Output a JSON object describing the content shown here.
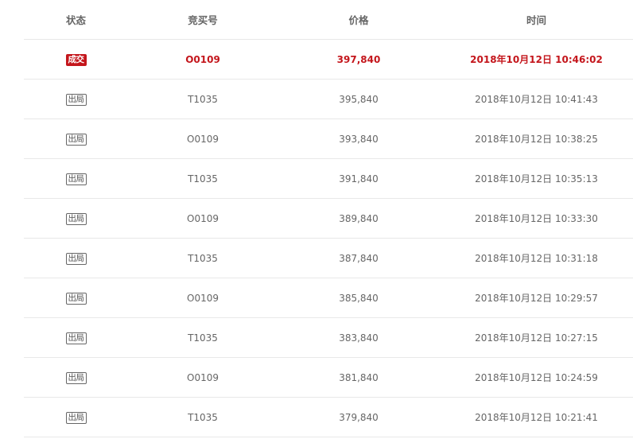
{
  "header": {
    "status": "状态",
    "bidder": "竞买号",
    "price": "价格",
    "time": "时间"
  },
  "rows": [
    {
      "status": "成交",
      "bidder": "O0109",
      "price": "397,840",
      "time": "2018年10月12日 10:46:02"
    },
    {
      "status": "出局",
      "bidder": "T1035",
      "price": "395,840",
      "time": "2018年10月12日 10:41:43"
    },
    {
      "status": "出局",
      "bidder": "O0109",
      "price": "393,840",
      "time": "2018年10月12日 10:38:25"
    },
    {
      "status": "出局",
      "bidder": "T1035",
      "price": "391,840",
      "time": "2018年10月12日 10:35:13"
    },
    {
      "status": "出局",
      "bidder": "O0109",
      "price": "389,840",
      "time": "2018年10月12日 10:33:30"
    },
    {
      "status": "出局",
      "bidder": "T1035",
      "price": "387,840",
      "time": "2018年10月12日 10:31:18"
    },
    {
      "status": "出局",
      "bidder": "O0109",
      "price": "385,840",
      "time": "2018年10月12日 10:29:57"
    },
    {
      "status": "出局",
      "bidder": "T1035",
      "price": "383,840",
      "time": "2018年10月12日 10:27:15"
    },
    {
      "status": "出局",
      "bidder": "O0109",
      "price": "381,840",
      "time": "2018年10月12日 10:24:59"
    },
    {
      "status": "出局",
      "bidder": "T1035",
      "price": "379,840",
      "time": "2018年10月12日 10:21:41"
    }
  ],
  "colors": {
    "accent": "#c4161c",
    "text": "#666666",
    "divider": "#e8e8e8"
  }
}
